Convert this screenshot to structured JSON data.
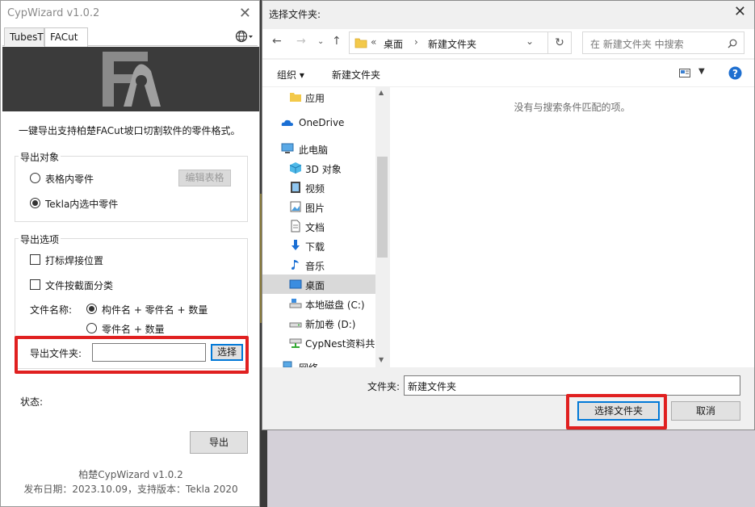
{
  "cypwizard": {
    "title": "CypWizard v1.0.2",
    "tabs": [
      "TubesT",
      "FACut"
    ],
    "description": "一键导出支持柏楚FACut坡口切割软件的零件格式。",
    "export_target": {
      "legend": "导出对象",
      "option1": "表格内零件",
      "option2": "Tekla内选中零件",
      "edit_table_button": "编辑表格",
      "selected": "option2"
    },
    "export_options": {
      "legend": "导出选项",
      "mark_weld": "打标焊接位置",
      "classify_by_section": "文件按截面分类",
      "filename_label": "文件名称:",
      "filename_opt1": "构件名 + 零件名 + 数量",
      "filename_opt2": "零件名 + 数量",
      "filename_selected": "opt1"
    },
    "export_folder_label": "导出文件夹:",
    "export_folder_value": "",
    "choose_button": "选择",
    "status_label": "状态:",
    "export_button": "导出",
    "footer_line1": "柏楚CypWizard v1.0.2",
    "footer_line2": "发布日期：2023.10.09，支持版本：Tekla 2020"
  },
  "dialog": {
    "title": "选择文件夹:",
    "breadcrumb": [
      "«",
      "桌面",
      "›",
      "新建文件夹"
    ],
    "search_placeholder": "在 新建文件夹 中搜索",
    "organize": "组织 ▾",
    "new_folder": "新建文件夹",
    "empty_message": "没有与搜索条件匹配的项。",
    "tree": [
      {
        "label": "应用",
        "icon": "folder-icon"
      },
      {
        "label": "OneDrive",
        "icon": "cloud-icon"
      },
      {
        "label": "此电脑",
        "icon": "computer-icon"
      },
      {
        "label": "3D 对象",
        "icon": "cube-icon"
      },
      {
        "label": "视频",
        "icon": "video-icon"
      },
      {
        "label": "图片",
        "icon": "picture-icon"
      },
      {
        "label": "文档",
        "icon": "document-icon"
      },
      {
        "label": "下载",
        "icon": "download-icon"
      },
      {
        "label": "音乐",
        "icon": "music-icon"
      },
      {
        "label": "桌面",
        "icon": "desktop-icon"
      },
      {
        "label": "本地磁盘 (C:)",
        "icon": "drive-icon"
      },
      {
        "label": "新加卷 (D:)",
        "icon": "drive-icon"
      },
      {
        "label": "CypNest资料共",
        "icon": "network-drive-icon"
      },
      {
        "label": "网络",
        "icon": "network-icon"
      }
    ],
    "folder_label": "文件夹:",
    "folder_value": "新建文件夹",
    "select_button": "选择文件夹",
    "cancel_button": "取消"
  }
}
